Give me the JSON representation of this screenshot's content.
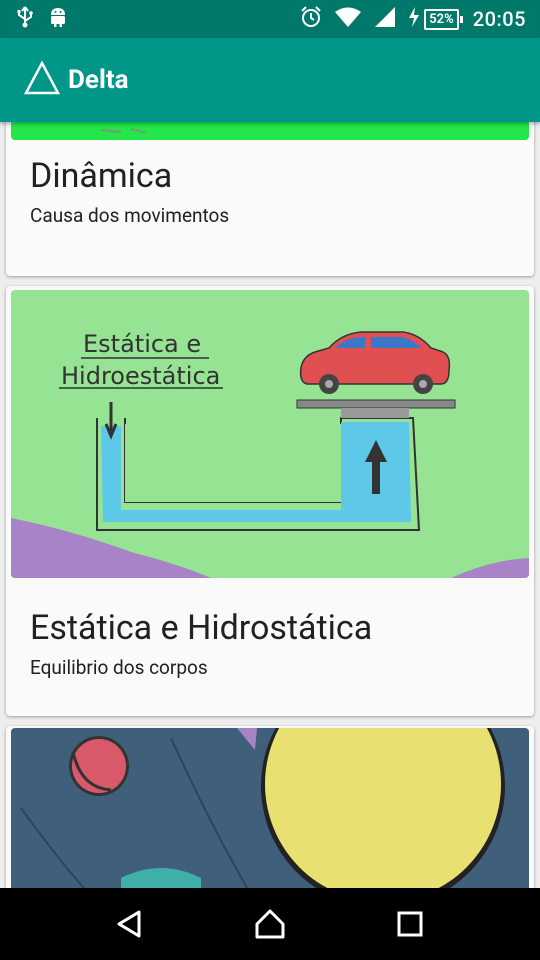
{
  "status_bar": {
    "time": "20:05",
    "battery_percent": "52%",
    "icons_left": [
      "usb-icon",
      "android-icon"
    ],
    "icons_right": [
      "alarm-icon",
      "wifi-icon",
      "signal-icon",
      "charging-icon",
      "battery-icon"
    ]
  },
  "app_bar": {
    "title": "Delta",
    "logo": "triangle-logo-icon",
    "color": "#009688",
    "status_color": "#00796b"
  },
  "cards": [
    {
      "title": "Dinâmica",
      "subtitle": "Causa dos movimentos"
    },
    {
      "title": "Estática e Hidrostática",
      "subtitle": "Equilibrio dos corpos",
      "image_text_line1": "Estática e",
      "image_text_line2": "Hidroestática"
    },
    {
      "title": "",
      "subtitle": ""
    }
  ],
  "nav_bar": {
    "icons": [
      "back-icon",
      "home-icon",
      "recents-icon"
    ]
  }
}
